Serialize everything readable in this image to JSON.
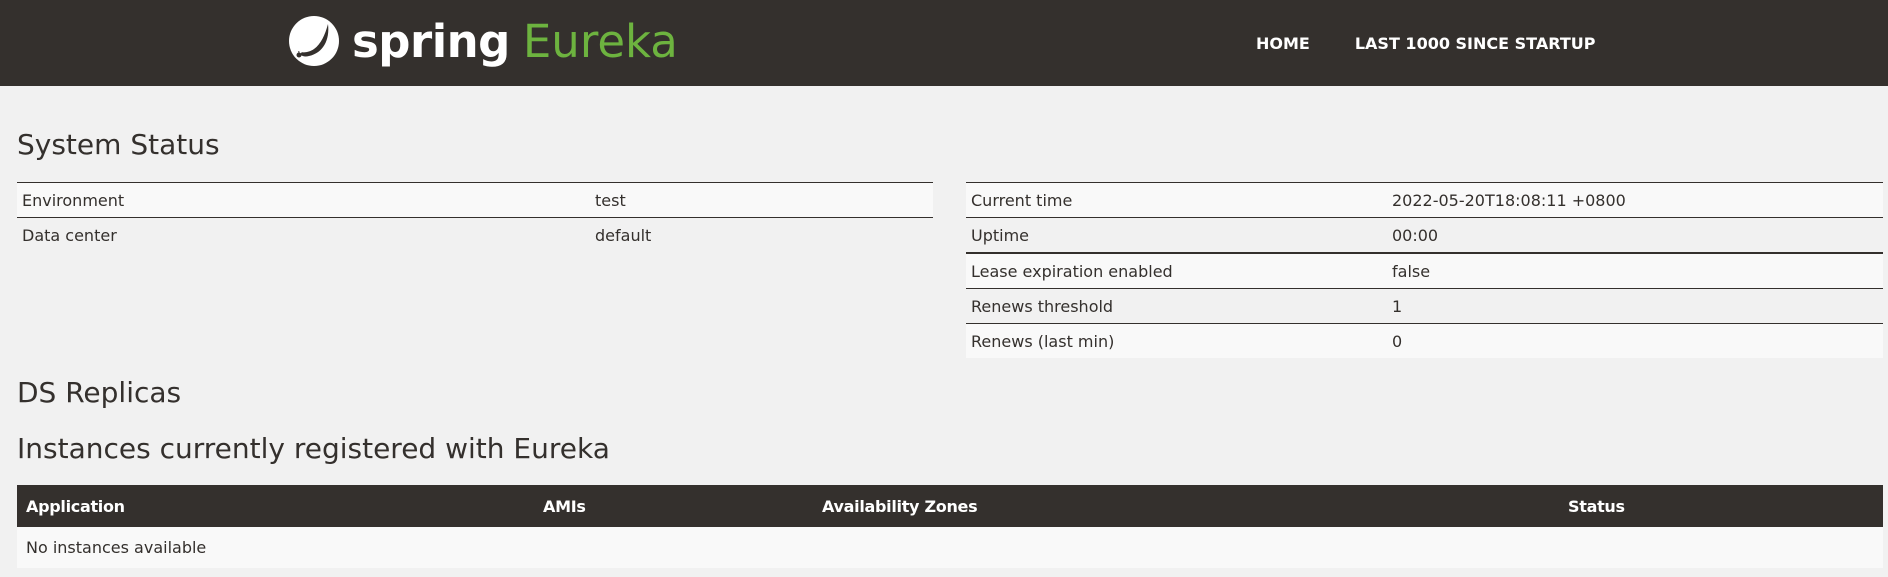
{
  "header": {
    "brand_spring": "spring",
    "brand_eureka": "Eureka",
    "logo_icon": "spring-leaf-icon",
    "nav": [
      {
        "label": "HOME"
      },
      {
        "label": "LAST 1000 SINCE STARTUP"
      }
    ]
  },
  "colors": {
    "navbar": "#34302d",
    "accent": "#6db33f",
    "background": "#f1f1f1"
  },
  "system_status": {
    "title": "System Status",
    "left": [
      {
        "label": "Environment",
        "value": "test"
      },
      {
        "label": "Data center",
        "value": "default"
      }
    ],
    "right": [
      {
        "label": "Current time",
        "value": "2022-05-20T18:08:11 +0800"
      },
      {
        "label": "Uptime",
        "value": "00:00"
      },
      {
        "label": "Lease expiration enabled",
        "value": "false"
      },
      {
        "label": "Renews threshold",
        "value": "1"
      },
      {
        "label": "Renews (last min)",
        "value": "0"
      }
    ]
  },
  "ds_replicas": {
    "title": "DS Replicas"
  },
  "instances": {
    "title": "Instances currently registered with Eureka",
    "columns": [
      "Application",
      "AMIs",
      "Availability Zones",
      "Status"
    ],
    "empty_text": "No instances available"
  }
}
